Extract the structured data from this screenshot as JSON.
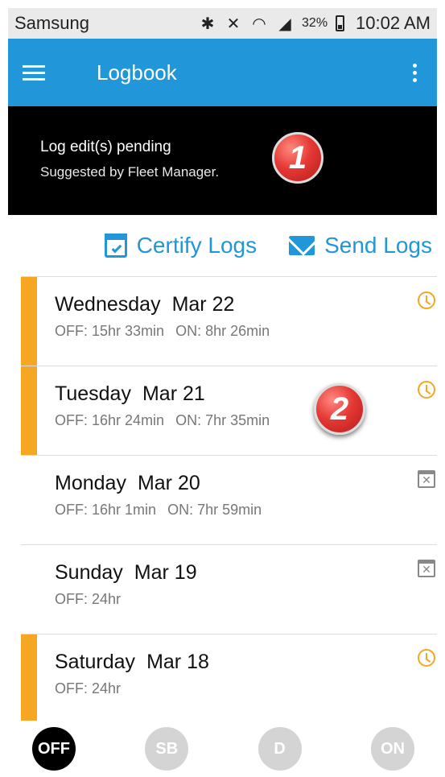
{
  "status_bar": {
    "carrier": "Samsung",
    "battery_percent": "32%",
    "time": "10:02 AM",
    "icons": [
      "bluetooth-icon",
      "mute-icon",
      "wifi-icon",
      "signal-icon",
      "battery-icon"
    ]
  },
  "app_bar": {
    "title": "Logbook",
    "menu_icon": "hamburger-menu-icon",
    "overflow_icon": "more-vert-icon",
    "color": "#2196d8"
  },
  "banner": {
    "title": "Log edit(s) pending",
    "subtitle": "Suggested by Fleet Manager.",
    "callout": "1"
  },
  "actions": {
    "certify_label": "Certify Logs",
    "send_label": "Send Logs"
  },
  "logs": [
    {
      "day": "Wednesday",
      "date": "Mar 22",
      "off_label": "OFF:",
      "off": "15hr 33min",
      "on_label": "ON:",
      "on": "8hr 26min",
      "pending": true,
      "status_icon": "clock-icon"
    },
    {
      "day": "Tuesday",
      "date": "Mar 21",
      "off_label": "OFF:",
      "off": "16hr 24min",
      "on_label": "ON:",
      "on": "7hr 35min",
      "pending": true,
      "status_icon": "clock-icon"
    },
    {
      "day": "Monday",
      "date": "Mar 20",
      "off_label": "OFF:",
      "off": "16hr 1min",
      "on_label": "ON:",
      "on": "7hr 59min",
      "pending": false,
      "status_icon": "calendar-x-icon"
    },
    {
      "day": "Sunday",
      "date": "Mar 19",
      "off_label": "OFF:",
      "off": "24hr",
      "pending": false,
      "status_icon": "calendar-x-icon"
    },
    {
      "day": "Saturday",
      "date": "Mar 18",
      "off_label": "OFF:",
      "off": "24hr",
      "pending": true,
      "status_icon": "clock-icon"
    }
  ],
  "list_callout": "2",
  "duty_status": {
    "buttons": [
      "OFF",
      "SB",
      "D",
      "ON"
    ],
    "active": "OFF"
  },
  "colors": {
    "accent": "#2196d8",
    "pending": "#f5a623",
    "banner_bg": "#000000",
    "callout": "#e53935"
  }
}
